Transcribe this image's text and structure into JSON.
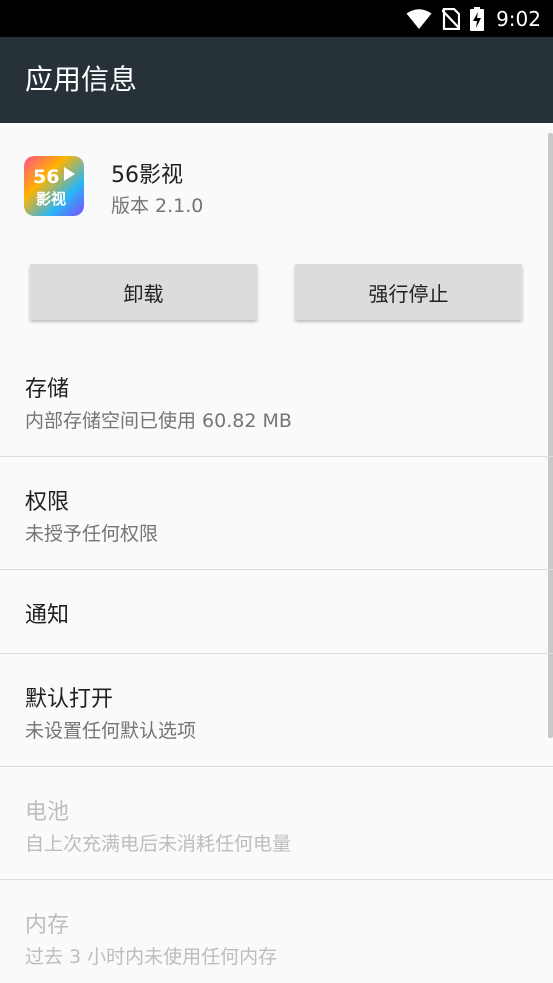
{
  "status_bar": {
    "time": "9:02",
    "icons": [
      "wifi-icon",
      "no-sim-icon",
      "battery-charging-icon"
    ]
  },
  "app_bar": {
    "title": "应用信息"
  },
  "app": {
    "icon": "app-56yingshi-icon",
    "icon_text_top": "56",
    "icon_text_bottom": "影视",
    "name": "56影视",
    "version": "版本 2.1.0"
  },
  "buttons": {
    "uninstall": "卸载",
    "force_stop": "强行停止"
  },
  "settings": {
    "storage": {
      "title": "存储",
      "summary": "内部存储空间已使用 60.82 MB"
    },
    "permissions": {
      "title": "权限",
      "summary": "未授予任何权限"
    },
    "notifications": {
      "title": "通知"
    },
    "open_by_default": {
      "title": "默认打开",
      "summary": "未设置任何默认选项"
    },
    "battery": {
      "title": "电池",
      "summary": "自上次充满电后未消耗任何电量"
    },
    "memory": {
      "title": "内存",
      "summary": "过去 3 小时内未使用任何内存"
    }
  }
}
